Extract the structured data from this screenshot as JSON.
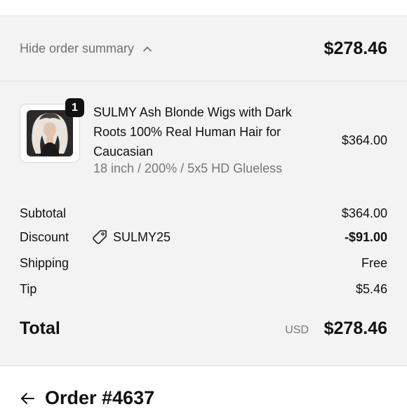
{
  "summary": {
    "toggle_label": "Hide order summary",
    "total": "$278.46"
  },
  "product": {
    "quantity": "1",
    "title": "SULMY Ash Blonde Wigs with Dark Roots 100% Real Human Hair for Caucasian",
    "variant": "18 inch / 200% / 5x5 HD Glueless",
    "price": "$364.00"
  },
  "costs": {
    "subtotal_label": "Subtotal",
    "subtotal_value": "$364.00",
    "discount_label": "Discount",
    "discount_code": "SULMY25",
    "discount_value": "-$91.00",
    "shipping_label": "Shipping",
    "shipping_value": "Free",
    "tip_label": "Tip",
    "tip_value": "$5.46",
    "total_label": "Total",
    "currency": "USD",
    "total_value": "$278.46"
  },
  "order": {
    "title": "Order #4637"
  },
  "icons": {
    "chevron": "chevron-up-icon",
    "tag": "tag-icon",
    "back": "arrow-left-icon"
  }
}
